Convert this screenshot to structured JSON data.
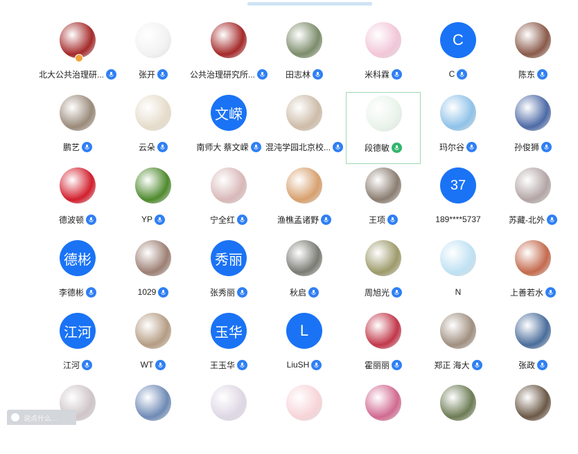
{
  "participants": [
    {
      "name": "北大公共治理研...",
      "avatar": {
        "type": "photo",
        "icon": "peking-university-seal",
        "color": "#a52a2a"
      },
      "mic": "blue",
      "host": true
    },
    {
      "name": "张开",
      "avatar": {
        "type": "photo",
        "icon": "sheep-cartoon",
        "color": "#f2f2f2"
      },
      "mic": "blue"
    },
    {
      "name": "公共治理研究所...",
      "avatar": {
        "type": "photo",
        "icon": "peking-university-seal",
        "color": "#a52a2a"
      },
      "mic": "blue"
    },
    {
      "name": "田志林",
      "avatar": {
        "type": "photo",
        "icon": "person-photo",
        "color": "#7c8c6b"
      },
      "mic": "blue"
    },
    {
      "name": "米科霖",
      "avatar": {
        "type": "photo",
        "icon": "anime-girl",
        "color": "#f2c6d8"
      },
      "mic": "blue"
    },
    {
      "name": "C",
      "avatar": {
        "type": "initial",
        "initial": "C"
      },
      "mic": "blue"
    },
    {
      "name": "陈东",
      "avatar": {
        "type": "photo",
        "icon": "city-night",
        "color": "#8a5a4a"
      },
      "mic": "blue"
    },
    {
      "name": "鹏艺",
      "avatar": {
        "type": "photo",
        "icon": "cat-photo",
        "color": "#9a8a7a"
      },
      "mic": "blue"
    },
    {
      "name": "云朵",
      "avatar": {
        "type": "photo",
        "icon": "girl-hat-cartoon",
        "color": "#e6dccb"
      },
      "mic": "blue"
    },
    {
      "name": "南师大 蔡文嵘",
      "avatar": {
        "type": "initial",
        "initial": "文嵘"
      },
      "mic": "blue"
    },
    {
      "name": "混沌学园北京校...",
      "avatar": {
        "type": "photo",
        "icon": "woman-photo",
        "color": "#cdbca8"
      },
      "mic": "blue"
    },
    {
      "name": "段德敏",
      "avatar": {
        "type": "photo",
        "icon": "penguin-logo",
        "color": "#e9f3ea"
      },
      "mic": "green",
      "selected": true
    },
    {
      "name": "玛尔谷",
      "avatar": {
        "type": "photo",
        "icon": "balloons-city",
        "color": "#8fc2e8"
      },
      "mic": "blue"
    },
    {
      "name": "孙俊狮",
      "avatar": {
        "type": "photo",
        "icon": "man-suit",
        "color": "#4d6aa6"
      },
      "mic": "blue"
    },
    {
      "name": "德波顿",
      "avatar": {
        "type": "photo",
        "icon": "red-abstract",
        "color": "#d21e2c"
      },
      "mic": "blue"
    },
    {
      "name": "YP",
      "avatar": {
        "type": "photo",
        "icon": "green-grass",
        "color": "#4f8a2e"
      },
      "mic": "blue"
    },
    {
      "name": "宁全红",
      "avatar": {
        "type": "photo",
        "icon": "flower-painting",
        "color": "#d9b8b8"
      },
      "mic": "blue"
    },
    {
      "name": "渔樵孟诸野",
      "avatar": {
        "type": "photo",
        "icon": "sunset-couple",
        "color": "#d7a06e"
      },
      "mic": "blue"
    },
    {
      "name": "王项",
      "avatar": {
        "type": "photo",
        "icon": "person-mask",
        "color": "#8b7d71"
      },
      "mic": "blue"
    },
    {
      "name": "189****5737",
      "avatar": {
        "type": "initial",
        "initial": "37"
      },
      "mic": "none"
    },
    {
      "name": "苏藏-北外",
      "avatar": {
        "type": "photo",
        "icon": "anime-boy",
        "color": "#b3a5a5"
      },
      "mic": "blue"
    },
    {
      "name": "李德彬",
      "avatar": {
        "type": "initial",
        "initial": "德彬"
      },
      "mic": "blue"
    },
    {
      "name": "1029",
      "avatar": {
        "type": "photo",
        "icon": "blossom-branch",
        "color": "#9c7f73"
      },
      "mic": "blue"
    },
    {
      "name": "张秀丽",
      "avatar": {
        "type": "initial",
        "initial": "秀丽"
      },
      "mic": "blue"
    },
    {
      "name": "秋启",
      "avatar": {
        "type": "photo",
        "icon": "calligraphy",
        "color": "#7b7b74"
      },
      "mic": "blue"
    },
    {
      "name": "周旭光",
      "avatar": {
        "type": "photo",
        "icon": "cartoon-creature",
        "color": "#9d9a6a"
      },
      "mic": "blue"
    },
    {
      "name": "N",
      "avatar": {
        "type": "photo",
        "icon": "sky-gradient",
        "color": "#bfe1f3"
      },
      "mic": "none"
    },
    {
      "name": "上善若水",
      "avatar": {
        "type": "photo",
        "icon": "colorful-door",
        "color": "#c46a4d"
      },
      "mic": "blue"
    },
    {
      "name": "江河",
      "avatar": {
        "type": "initial",
        "initial": "江河"
      },
      "mic": "blue"
    },
    {
      "name": "WT",
      "avatar": {
        "type": "photo",
        "icon": "painting-people",
        "color": "#b59c83"
      },
      "mic": "blue"
    },
    {
      "name": "王玉华",
      "avatar": {
        "type": "initial",
        "initial": "玉华"
      },
      "mic": "blue"
    },
    {
      "name": "LiuSH",
      "avatar": {
        "type": "initial",
        "initial": "L"
      },
      "mic": "blue"
    },
    {
      "name": "霍丽丽",
      "avatar": {
        "type": "photo",
        "icon": "red-flower",
        "color": "#c2374a"
      },
      "mic": "blue"
    },
    {
      "name": "郑正 海大",
      "avatar": {
        "type": "photo",
        "icon": "cat-photo",
        "color": "#a08f7f"
      },
      "mic": "blue"
    },
    {
      "name": "张政",
      "avatar": {
        "type": "photo",
        "icon": "fireworks",
        "color": "#4a6d9b"
      },
      "mic": "blue"
    },
    {
      "name": "",
      "avatar": {
        "type": "photo",
        "icon": "map-photo",
        "color": "#cfc5c8"
      },
      "mic": "none"
    },
    {
      "name": "",
      "avatar": {
        "type": "photo",
        "icon": "tree-sky",
        "color": "#6e8ab5"
      },
      "mic": "none"
    },
    {
      "name": "",
      "avatar": {
        "type": "photo",
        "icon": "bird-art",
        "color": "#ded7e4"
      },
      "mic": "none"
    },
    {
      "name": "",
      "avatar": {
        "type": "photo",
        "icon": "pink-cartoon",
        "color": "#f7d4d8"
      },
      "mic": "none"
    },
    {
      "name": "",
      "avatar": {
        "type": "photo",
        "icon": "lotus-flower",
        "color": "#d16a90"
      },
      "mic": "none"
    },
    {
      "name": "",
      "avatar": {
        "type": "photo",
        "icon": "landscape",
        "color": "#6d7c55"
      },
      "mic": "none"
    },
    {
      "name": "",
      "avatar": {
        "type": "photo",
        "icon": "interior-photo",
        "color": "#6b5846"
      },
      "mic": "none"
    }
  ],
  "chat": {
    "placeholder": "说点什么..."
  },
  "colors": {
    "mic_blue": "#2f7ff5",
    "mic_green": "#31b56c",
    "initial_bg": "#1a73f5"
  }
}
